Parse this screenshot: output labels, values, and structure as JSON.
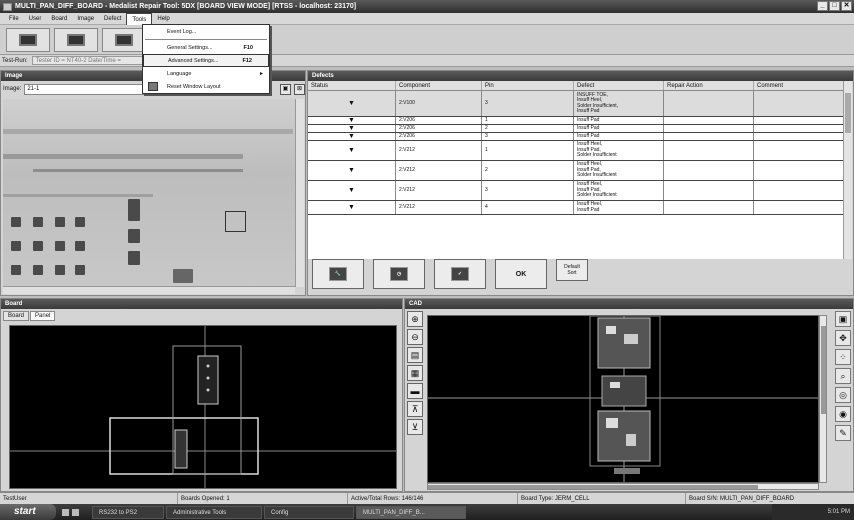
{
  "window": {
    "title": "MULTI_PAN_DIFF_BOARD - Medalist Repair Tool: 5DX [BOARD VIEW MODE] [RTSS - localhost: 23170]"
  },
  "menu": {
    "items": [
      "File",
      "User",
      "Board",
      "Image",
      "Defect",
      "Tools",
      "Help"
    ],
    "active": "Tools"
  },
  "tools_menu": {
    "event_log": "Event Log...",
    "general_settings": "General Settings...",
    "general_shortcut": "F10",
    "advanced_settings": "Advanced Settings...",
    "advanced_shortcut": "F12",
    "language": "Language",
    "reset_layout": "Reset Window Layout"
  },
  "testrun": {
    "label": "Test-Run:",
    "value": "Tester ID = NT40-2 Date/Time ="
  },
  "image_panel": {
    "title": "Image",
    "image_label": "Image:",
    "image_value": "21-1"
  },
  "defects_panel": {
    "title": "Defects",
    "columns": [
      "Status",
      "Component",
      "Pin",
      "Defect",
      "Repair Action",
      "Comment"
    ],
    "rows": [
      {
        "component": "2:V100",
        "pin": "3",
        "defect": [
          "INSUFF TOE,",
          "Insuff Heel,",
          "Solder Insufficient,",
          "Insuff Pad"
        ]
      },
      {
        "component": "2:V206",
        "pin": "1",
        "defect": [
          "Insuff Pad"
        ]
      },
      {
        "component": "2:V206",
        "pin": "2",
        "defect": [
          "Insuff Pad"
        ]
      },
      {
        "component": "2:V206",
        "pin": "3",
        "defect": [
          "Insuff Pad"
        ]
      },
      {
        "component": "2:V212",
        "pin": "1",
        "defect": [
          "Insuff Heel,",
          "Insuff Pad,",
          "Solder Insufficient"
        ]
      },
      {
        "component": "2:V212",
        "pin": "2",
        "defect": [
          "Insuff Heel,",
          "Insuff Pad,",
          "Solder Insufficient"
        ]
      },
      {
        "component": "2:V212",
        "pin": "3",
        "defect": [
          "Insuff Heel,",
          "Insuff Pad,",
          "Solder Insufficient"
        ]
      },
      {
        "component": "2:V212",
        "pin": "4",
        "defect": [
          "Insuff Heel,",
          "Insuff Pad"
        ]
      }
    ],
    "ok_label": "OK",
    "default_sort": [
      "Default",
      "Sort"
    ]
  },
  "board_panel": {
    "title": "Board",
    "tabs": [
      "Board",
      "Panel"
    ],
    "active_tab": "Panel"
  },
  "cad_panel": {
    "title": "CAD"
  },
  "statusbar": {
    "user": "TestUser",
    "boards_opened": "Boards Opened: 1",
    "rows": "Active/Total Rows: 146/146",
    "board_type": "Board Type: JERM_CELL",
    "board_sn": "Board S/N: MULTI_PAN_DIFF_BOARD"
  },
  "taskbar": {
    "start": "start",
    "tasks": [
      "RS232 to PS2",
      "Administrative Tools",
      "Config",
      "MULTI_PAN_DIFF_B..."
    ],
    "time": "5:01 PM"
  }
}
